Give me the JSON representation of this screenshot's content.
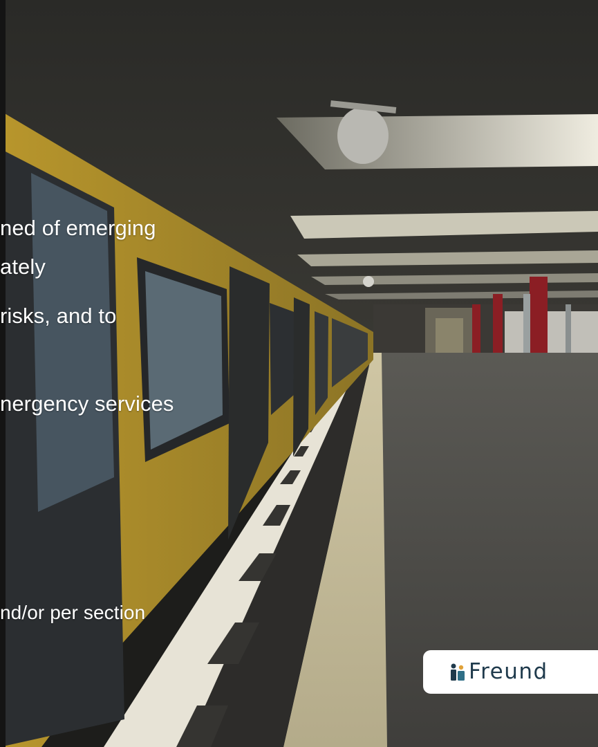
{
  "caption_lines": [
    "ned of emerging",
    "ately",
    "risks, and to",
    "nergency services",
    "nd/or per section"
  ],
  "logo": {
    "text": "Freund",
    "icon": "freund-logo-mark-icon",
    "text_color": "#1f3a4c",
    "accent_color": "#e0a23a"
  },
  "colors": {
    "train_yellow": "#c9a93a",
    "platform_gray": "#4a4a48",
    "ceiling_light": "#e9e6d5",
    "pillar_red": "#8b1e24"
  }
}
